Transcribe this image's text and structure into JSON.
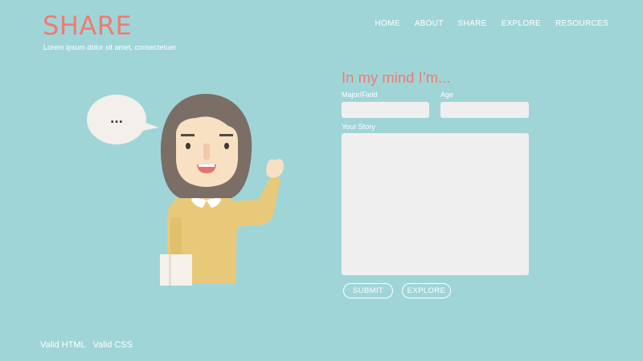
{
  "header": {
    "logo": "SHARE",
    "tagline": "Lorem ipsum dolor sit amet, consectetuer"
  },
  "nav": {
    "items": [
      "HOME",
      "ABOUT",
      "SHARE",
      "EXPLORE",
      "RESOURCES"
    ]
  },
  "illustration": {
    "speech_bubble_text": "..."
  },
  "form": {
    "title": "In my mind I’m...",
    "major_label": "Major/Field",
    "major_value": "",
    "age_label": "Age",
    "age_value": "",
    "story_label": "Your Story",
    "story_value": "",
    "submit_label": "SUBMIT",
    "explore_label": "EXPLORE"
  },
  "footer": {
    "links": [
      "Valid HTML",
      "Valid CSS"
    ]
  },
  "colors": {
    "background": "#a0d5d8",
    "accent": "#f07b72",
    "field": "#efefef",
    "sweater": "#e8c979",
    "hair": "#7a6e66",
    "skin": "#f8e0c3",
    "bubble": "#f3efea"
  }
}
